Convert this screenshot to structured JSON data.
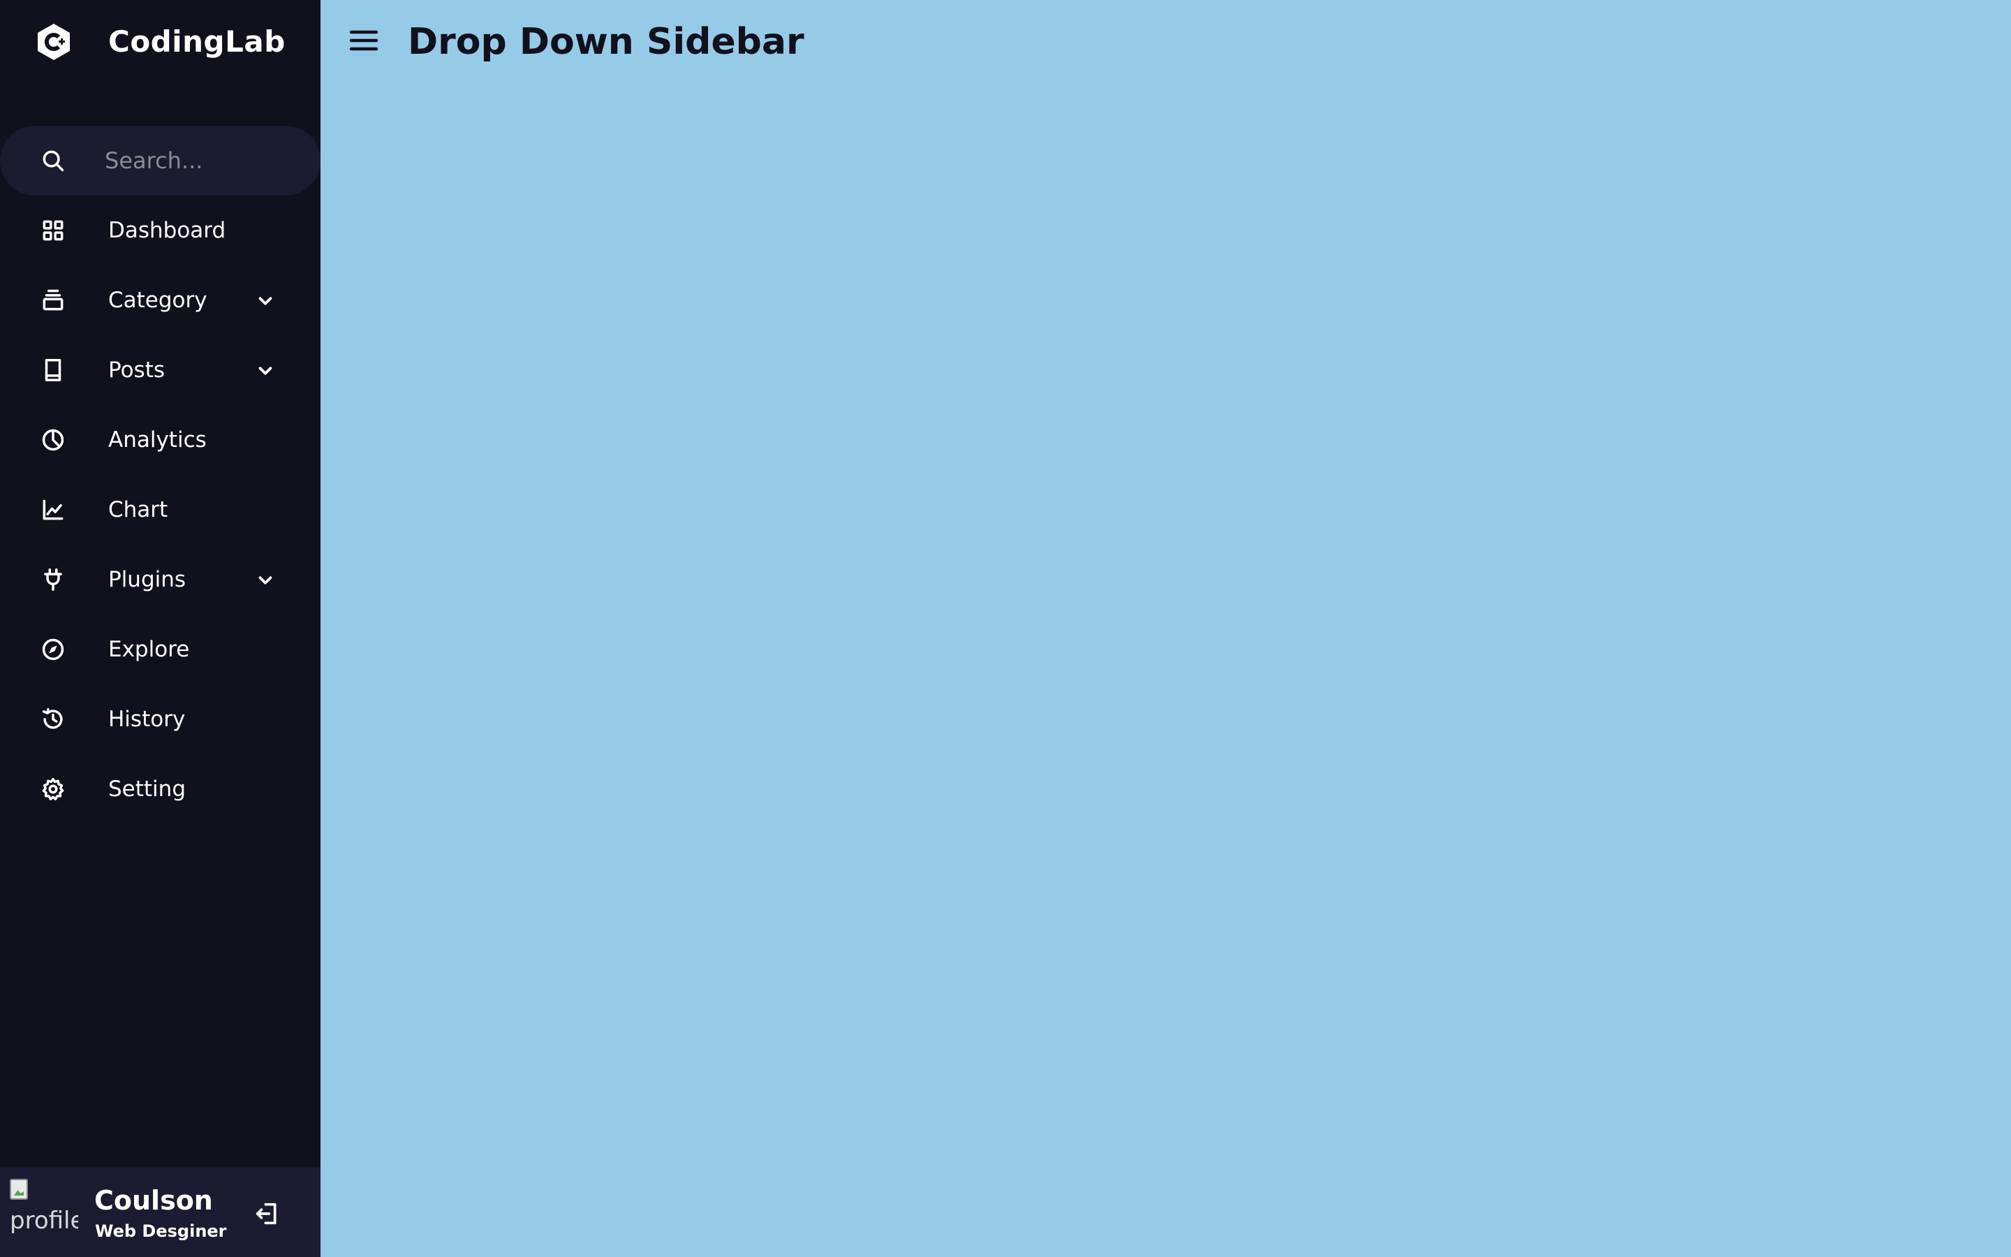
{
  "logo": {
    "name": "CodingLab",
    "icon": "c-plus-plus-icon"
  },
  "search": {
    "placeholder": "Search...",
    "value": ""
  },
  "nav": {
    "items": [
      {
        "label": "Dashboard",
        "icon": "grid-icon",
        "has_dropdown": false
      },
      {
        "label": "Category",
        "icon": "collection-icon",
        "has_dropdown": true
      },
      {
        "label": "Posts",
        "icon": "book-icon",
        "has_dropdown": true
      },
      {
        "label": "Analytics",
        "icon": "pie-chart-icon",
        "has_dropdown": false
      },
      {
        "label": "Chart",
        "icon": "line-chart-icon",
        "has_dropdown": false
      },
      {
        "label": "Plugins",
        "icon": "plug-icon",
        "has_dropdown": true
      },
      {
        "label": "Explore",
        "icon": "compass-icon",
        "has_dropdown": false
      },
      {
        "label": "History",
        "icon": "history-icon",
        "has_dropdown": false
      },
      {
        "label": "Setting",
        "icon": "cog-icon",
        "has_dropdown": false
      }
    ]
  },
  "profile": {
    "image_alt": "profile",
    "name": "Coulson",
    "job": "Web Desginer"
  },
  "main": {
    "title": "Drop Down Sidebar"
  },
  "colors": {
    "sidebar_bg": "#11101d",
    "sidebar_accent_bg": "#1d1b31",
    "main_bg": "#96cbe7",
    "text_light": "#ffffff",
    "text_dark": "#11101d"
  }
}
